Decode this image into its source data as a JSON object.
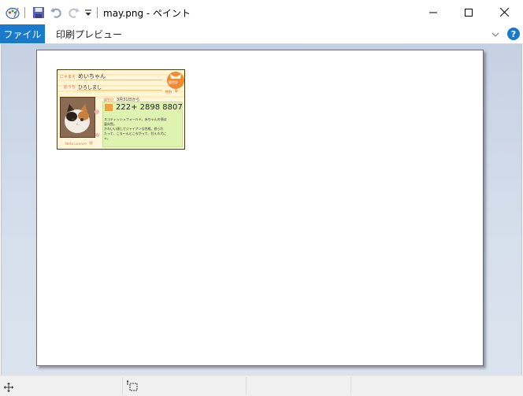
{
  "window": {
    "title": "may.png - ペイント"
  },
  "ribbon": {
    "file_tab": "ファイル",
    "tabs": [
      "印刷プレビュー"
    ]
  },
  "card": {
    "name_label": "にゃまえ",
    "name": "めいちゃん",
    "home_label": "おうち",
    "home": "ひろしまし",
    "seal_text": "猫免許",
    "gender_label": "性別",
    "gender": "♀",
    "birthday_label": "誕生日",
    "birthday": "3月31日から",
    "number": "222+ 2898 8807",
    "bio": [
      "スコティッシュフォールド。赤ちゃんの頃は",
      "裏向覧。",
      "かわいい顔してジャイアンな性格。怒られ",
      "たって、ころ～んところがって、甘える犬に",
      "ゃ。"
    ],
    "footer": "Neko Licence"
  },
  "colors": {
    "accent": "#1979ca",
    "card_bg": "#fff6d8",
    "card_green": "#dff3b0"
  }
}
